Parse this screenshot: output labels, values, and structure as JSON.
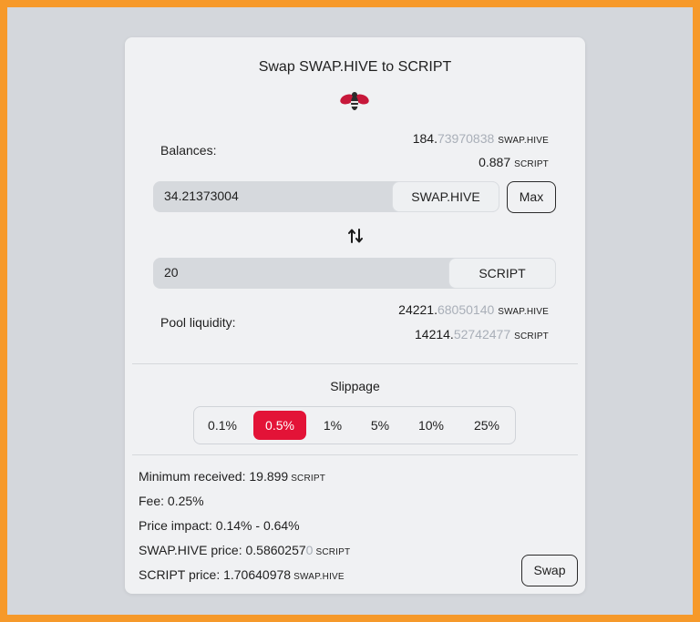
{
  "title": "Swap SWAP.HIVE to SCRIPT",
  "logo_icon": "hive-bee-logo",
  "balances": {
    "label": "Balances:",
    "rows": [
      {
        "int": "184.",
        "dec": "73970838",
        "unit": "SWAP.HIVE"
      },
      {
        "int": "0.887",
        "dec": "",
        "unit": "SCRIPT"
      }
    ]
  },
  "from": {
    "value": "34.21373004",
    "token": "SWAP.HIVE"
  },
  "max_label": "Max",
  "to": {
    "value": "20",
    "token": "SCRIPT"
  },
  "pool": {
    "label": "Pool liquidity:",
    "rows": [
      {
        "int": "24221.",
        "dec": "68050140",
        "unit": "SWAP.HIVE"
      },
      {
        "int": "14214.",
        "dec": "52742477",
        "unit": "SCRIPT"
      }
    ]
  },
  "slippage": {
    "title": "Slippage",
    "options": [
      "0.1%",
      "0.5%",
      "1%",
      "5%",
      "10%",
      "25%"
    ],
    "selected": "0.5%"
  },
  "info": {
    "min_received": {
      "label": "Minimum received: 19.899",
      "unit": "SCRIPT"
    },
    "fee": "Fee: 0.25%",
    "price_impact": "Price impact: 0.14% - 0.64%",
    "swaphive_price": {
      "label": "SWAP.HIVE price: 0.5860257",
      "dim": "0",
      "unit": "SCRIPT"
    },
    "script_price": {
      "label": "SCRIPT price: 1.70640978",
      "unit": "SWAP.HIVE"
    }
  },
  "swap_label": "Swap",
  "colors": {
    "accent": "#e31337",
    "frame": "#f6992a",
    "backdrop": "#d4d7dc",
    "card": "#f0f1f3"
  }
}
